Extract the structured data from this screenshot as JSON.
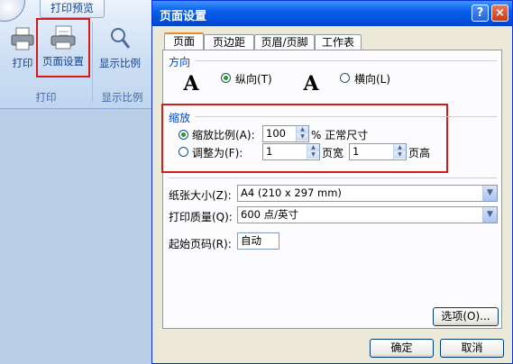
{
  "ribbon": {
    "tab_label": "打印预览",
    "print_label": "打印",
    "page_setup_label": "页面设置",
    "zoom_label": "显示比例",
    "group_print": "打印",
    "group_zoom": "显示比例"
  },
  "dialog": {
    "title": "页面设置",
    "help_button": "?",
    "close_button": "×",
    "tabs": [
      "页面",
      "页边距",
      "页眉/页脚",
      "工作表"
    ],
    "orientation": {
      "heading": "方向",
      "portrait_label": "纵向(T)",
      "landscape_label": "横向(L)",
      "selected": "portrait"
    },
    "scaling": {
      "heading": "缩放",
      "adjust_label": "缩放比例(A):",
      "adjust_value": "100",
      "adjust_suffix": "% 正常尺寸",
      "fit_label": "调整为(F):",
      "fit_wide_value": "1",
      "fit_wide_suffix": "页宽",
      "fit_tall_value": "1",
      "fit_tall_suffix": "页高",
      "selected": "adjust"
    },
    "paper_size": {
      "label": "纸张大小(Z):",
      "value": "A4 (210 x 297 mm)"
    },
    "print_quality": {
      "label": "打印质量(Q):",
      "value": "600 点/英寸"
    },
    "first_page": {
      "label": "起始页码(R):",
      "value": "自动"
    },
    "options_button": "选项(O)...",
    "ok_button": "确定",
    "cancel_button": "取消",
    "page_glyph": "A"
  }
}
